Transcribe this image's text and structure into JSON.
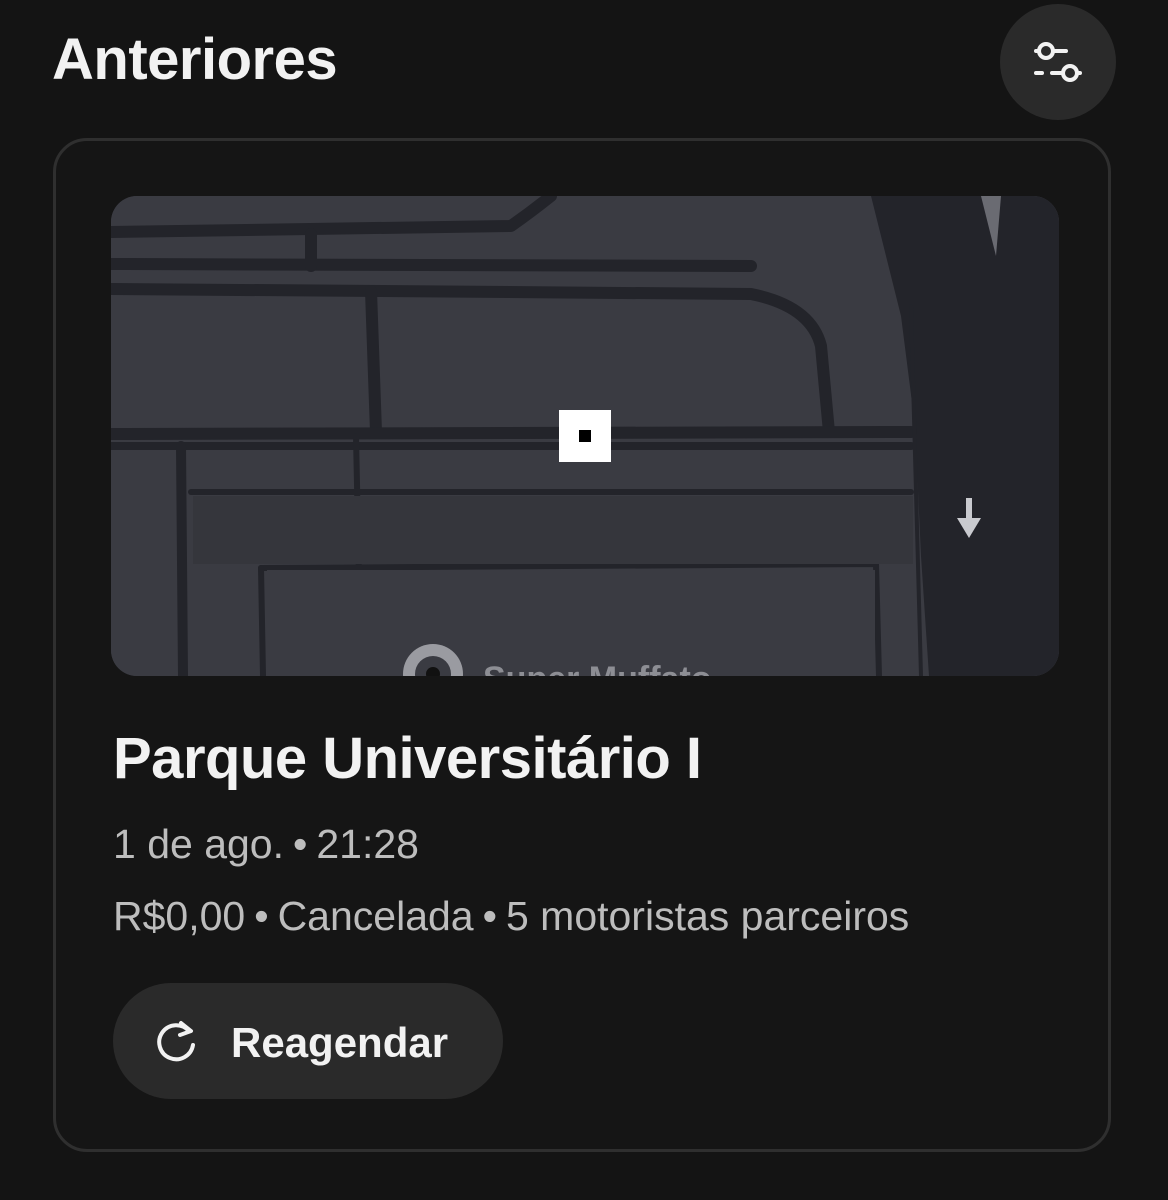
{
  "header": {
    "title": "Anteriores",
    "filter_icon": "sliders-filter-icon"
  },
  "trip_card": {
    "map": {
      "poi_label": "Super Muffato",
      "pin_icon": "map-pin-square-icon",
      "direction_icon": "arrow-down-icon",
      "poi_icon": "location-marker-icon"
    },
    "place_title": "Parque Universitário I",
    "date": "1 de ago.",
    "time": "21:28",
    "separator": "•",
    "price": "R$0,00",
    "status": "Cancelada",
    "drivers": "5 motoristas parceiros",
    "reschedule_label": "Reagendar",
    "reschedule_icon": "refresh-icon"
  },
  "colors": {
    "background": "#141414",
    "card_border": "#2f2f2f",
    "button_bg": "#2a2a2a",
    "map_block": "#3a3b42",
    "map_road": "#23242a",
    "text_primary": "#f2f2f2",
    "text_secondary": "#bdbdbd"
  }
}
